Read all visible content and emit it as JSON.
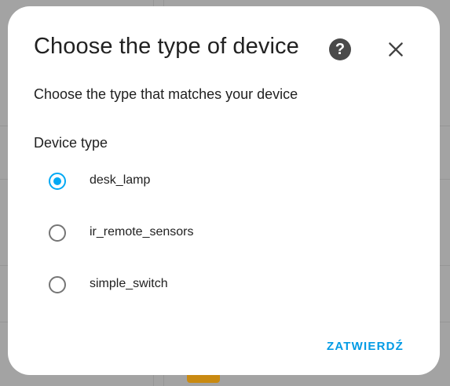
{
  "dialog": {
    "title": "Choose the type of device",
    "subtitle": "Choose the type that matches your device",
    "help_icon": "help-circle-icon",
    "close_icon": "close-icon",
    "group_label": "Device type",
    "options": [
      {
        "label": "desk_lamp",
        "selected": true
      },
      {
        "label": "ir_remote_sensors",
        "selected": false
      },
      {
        "label": "simple_switch",
        "selected": false
      }
    ],
    "confirm_label": "ZATWIERDŹ"
  },
  "colors": {
    "accent": "#03a9f4",
    "button_text": "#039be5",
    "text": "#212121",
    "radio_unchecked": "#757575",
    "backdrop": "#a3a3a3"
  }
}
